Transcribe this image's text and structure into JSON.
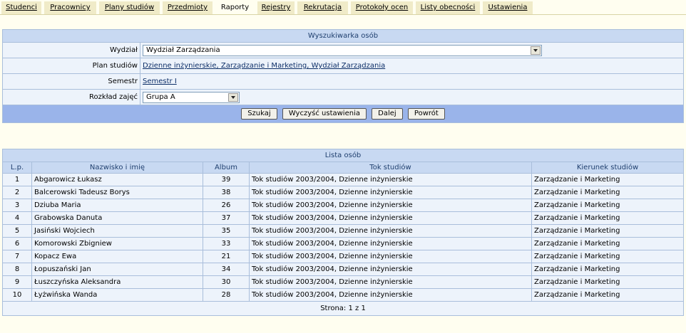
{
  "tabs": [
    {
      "label": "Studenci"
    },
    {
      "label": "Pracownicy"
    },
    {
      "label": "Plany studiów"
    },
    {
      "label": "Przedmioty"
    },
    {
      "label": "Raporty"
    },
    {
      "label": "Rejestry"
    },
    {
      "label": "Rekrutacja"
    },
    {
      "label": "Protokoły ocen"
    },
    {
      "label": "Listy obecności"
    },
    {
      "label": "Ustawienia"
    }
  ],
  "active_tab": "Raporty",
  "search": {
    "title": "Wyszukiwarka osób",
    "wydzial_label": "Wydział",
    "wydzial_value": "Wydział Zarządzania",
    "plan_label": "Plan studiów",
    "plan_value": "Dzienne inżynierskie, Zarządzanie i Marketing, Wydział Zarządzania",
    "semestr_label": "Semestr",
    "semestr_value": "Semestr I",
    "rozklad_label": "Rozkład zajęć",
    "rozklad_value": "Grupa A",
    "buttons": {
      "search": "Szukaj",
      "clear": "Wyczyść ustawienia",
      "next": "Dalej",
      "back": "Powrót"
    }
  },
  "list": {
    "title": "Lista osób",
    "columns": [
      "L.p.",
      "Nazwisko i imię",
      "Album",
      "Tok studiów",
      "Kierunek studiów"
    ],
    "rows": [
      {
        "lp": "1",
        "name": "Abgarowicz Łukasz",
        "album": "39",
        "tok": "Tok studiów 2003/2004, Dzienne inżynierskie",
        "kierunek": "Zarządzanie i Marketing"
      },
      {
        "lp": "2",
        "name": "Balcerowski Tadeusz Borys",
        "album": "38",
        "tok": "Tok studiów 2003/2004, Dzienne inżynierskie",
        "kierunek": "Zarządzanie i Marketing"
      },
      {
        "lp": "3",
        "name": "Dziuba Maria",
        "album": "26",
        "tok": "Tok studiów 2003/2004, Dzienne inżynierskie",
        "kierunek": "Zarządzanie i Marketing"
      },
      {
        "lp": "4",
        "name": "Grabowska Danuta",
        "album": "37",
        "tok": "Tok studiów 2003/2004, Dzienne inżynierskie",
        "kierunek": "Zarządzanie i Marketing"
      },
      {
        "lp": "5",
        "name": "Jasiński Wojciech",
        "album": "35",
        "tok": "Tok studiów 2003/2004, Dzienne inżynierskie",
        "kierunek": "Zarządzanie i Marketing"
      },
      {
        "lp": "6",
        "name": "Komorowski Zbigniew",
        "album": "33",
        "tok": "Tok studiów 2003/2004, Dzienne inżynierskie",
        "kierunek": "Zarządzanie i Marketing"
      },
      {
        "lp": "7",
        "name": "Kopacz Ewa",
        "album": "21",
        "tok": "Tok studiów 2003/2004, Dzienne inżynierskie",
        "kierunek": "Zarządzanie i Marketing"
      },
      {
        "lp": "8",
        "name": "Łopuszański Jan",
        "album": "34",
        "tok": "Tok studiów 2003/2004, Dzienne inżynierskie",
        "kierunek": "Zarządzanie i Marketing"
      },
      {
        "lp": "9",
        "name": "Łuszczyńska Aleksandra",
        "album": "30",
        "tok": "Tok studiów 2003/2004, Dzienne inżynierskie",
        "kierunek": "Zarządzanie i Marketing"
      },
      {
        "lp": "10",
        "name": "Łyżwińska Wanda",
        "album": "28",
        "tok": "Tok studiów 2003/2004, Dzienne inżynierskie",
        "kierunek": "Zarządzanie i Marketing"
      }
    ],
    "footer": "Strona: 1 z 1"
  },
  "colors": {
    "page_bg": "#FFFEF0",
    "tab_bg": "#F0EBC8",
    "header_bg": "#C8D9F2",
    "row_bg": "#EDF3FB",
    "button_bar_bg": "#9AB4EA",
    "border": "#A9BEDB"
  }
}
